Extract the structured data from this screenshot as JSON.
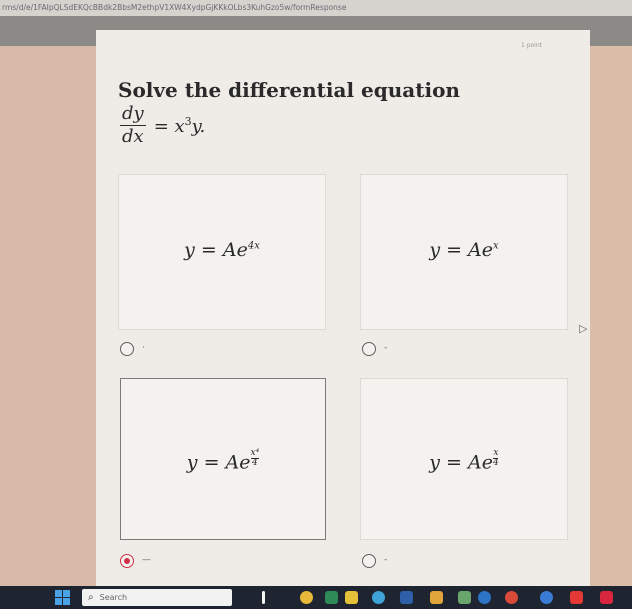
{
  "browser": {
    "url": "rms/d/e/1FAIpQLSdEKQcBBdk2BbsM2ethpV1XW4XydpGjKKkOLbs3KuhGzo5w/formResponse"
  },
  "question": {
    "points": "1 point",
    "prompt": "Solve the differential equation",
    "equation": {
      "numerator": "dy",
      "denominator": "dx",
      "rhs_base": "= x",
      "rhs_exp": "3",
      "rhs_tail": "y."
    }
  },
  "options": [
    {
      "prefix": "y = Ae",
      "exp": "4x",
      "selected": false
    },
    {
      "prefix": "y = Ae",
      "exp": "x",
      "selected": false
    },
    {
      "prefix": "y = Ae",
      "exp_num": "x⁴",
      "exp_den": "4",
      "selected": true
    },
    {
      "prefix": "y = Ae",
      "exp_num": "x",
      "exp_den": "4",
      "selected": false
    }
  ],
  "taskbar": {
    "search_placeholder": "Search",
    "search_icon": "search-icon",
    "start_icon": "windows-start-icon"
  },
  "colors": {
    "accent": "#d0324a",
    "side_margin": "#d8b9a7",
    "taskbar": "#1e2530"
  }
}
